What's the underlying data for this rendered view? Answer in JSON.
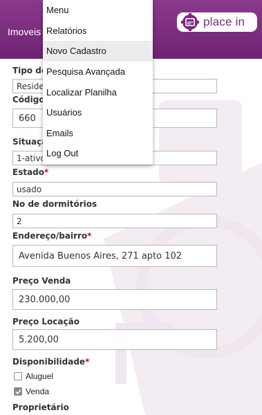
{
  "header": {
    "title": "Imoveis",
    "logo_text": "place in"
  },
  "menu": {
    "items": [
      {
        "label": "Menu"
      },
      {
        "label": "Relatórios"
      },
      {
        "label": "Novo Cadastro",
        "active": true
      },
      {
        "label": "Pesquisa Avançada"
      },
      {
        "label": "Localizar Planilha"
      },
      {
        "label": "Usuários"
      },
      {
        "label": "Emails"
      },
      {
        "label": "Log Out"
      }
    ]
  },
  "form": {
    "tipo": {
      "label": "Tipo de",
      "value": "Reside"
    },
    "codigo": {
      "label": "Código",
      "value": "660"
    },
    "situacao": {
      "label": "Situaçã",
      "value": "1-ativo"
    },
    "estado": {
      "label": "Estado",
      "value": "usado"
    },
    "dormitorios": {
      "label": "No de dormitórios",
      "value": "2"
    },
    "endereco": {
      "label": "Endereço/bairro",
      "value": "Avenida Buenos Aires, 271 apto 102"
    },
    "preco_venda": {
      "label": "Preço Venda",
      "value": "230.000,00"
    },
    "preco_locacao": {
      "label": "Preço Locação",
      "value": "5.200,00"
    },
    "disponibilidade": {
      "label": "Disponibilidade",
      "options": [
        {
          "label": "Aluguel",
          "checked": false
        },
        {
          "label": "Venda",
          "checked": true
        }
      ]
    },
    "proprietario": {
      "label": "Proprietário"
    },
    "required_marker": "*"
  },
  "colors": {
    "header": "#7a2a7e",
    "required": "#d8000c"
  }
}
